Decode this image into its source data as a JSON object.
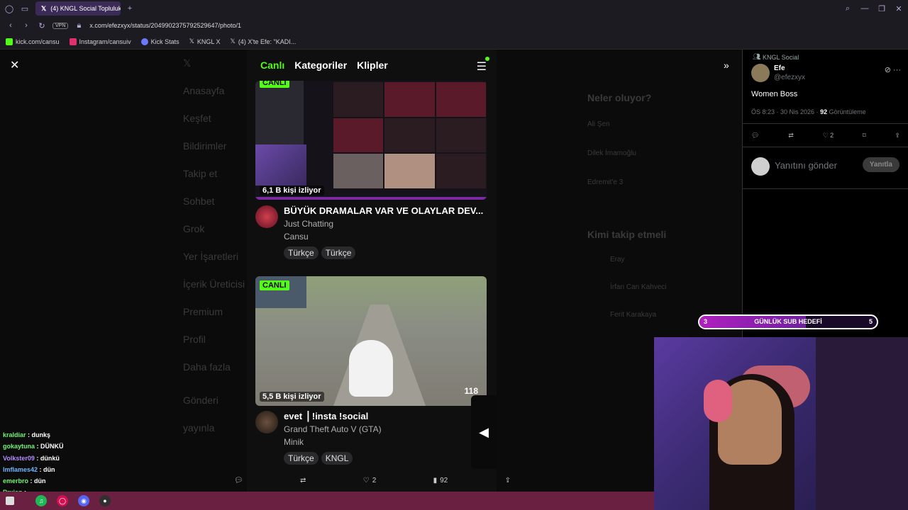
{
  "browser": {
    "tab_title": "(4) KNGL Social Topluluk /",
    "vpn": "VPN",
    "url": "x.com/efezxyx/status/2049902375792529647/photo/1",
    "bookmarks": [
      {
        "label": "kick.com/cansu"
      },
      {
        "label": "Instagram/cansuiv"
      },
      {
        "label": "Kick Stats"
      },
      {
        "label": "KNGL X"
      },
      {
        "label": "(4) X'te Efe: \"KADI..."
      }
    ]
  },
  "kick": {
    "tabs": [
      "Canlı",
      "Kategoriler",
      "Klipler"
    ],
    "streams": [
      {
        "live_badge": "CANLI",
        "viewers": "6,1 B kişi izliyor",
        "title": "BÜYÜK DRAMALAR VAR VE OLAYLAR DEV...",
        "category": "Just Chatting",
        "user": "Cansu",
        "tags": [
          "Türkçe",
          "Türkçe"
        ]
      },
      {
        "live_badge": "CANLI",
        "viewers": "5,5 B kişi izliyor",
        "title": "evet ⎥ !insta !social",
        "category": "Grand Theft Auto V (GTA)",
        "user": "Minik",
        "tags": [
          "Türkçe",
          "KNGL"
        ],
        "speed": "118"
      }
    ]
  },
  "photo_actions": {
    "likes": "2",
    "views": "92"
  },
  "tweet": {
    "community": "KNGL Social",
    "name": "Efe",
    "handle": "@efezxyx",
    "text": "Women Boss",
    "meta_time": "ÖS 8:23 · 30 Nis 2026 · ",
    "meta_views": "92",
    "meta_views_label": " Görüntüleme",
    "likes": "2",
    "reply_placeholder": "Yanıtını gönder",
    "reply_button": "Yanıtla"
  },
  "sub_goal": {
    "label": "GÜNLÜK SUB HEDEFİ",
    "current": "3",
    "target": "5",
    "progress": 0.6
  },
  "chat": [
    {
      "user": "kraldiar",
      "color": "#6ff56f",
      "msg": "dunkş"
    },
    {
      "user": "gokaytuna",
      "color": "#6ff56f",
      "msg": "DÜNKÜ"
    },
    {
      "user": "Volkster09",
      "color": "#b38cff",
      "msg": "dünkü"
    },
    {
      "user": "lmflames42",
      "color": "#6fb8ff",
      "msg": "dün"
    },
    {
      "user": "emerbro",
      "color": "#6ff56f",
      "msg": "dün"
    },
    {
      "user": "Prxien",
      "color": "#6ff56f",
      "msg": ""
    },
    {
      "user": "Efnogu",
      "color": "#ffffff",
      "msg": "dün"
    }
  ],
  "dim_background": {
    "nav": [
      "Anasayfa",
      "Keşfet",
      "Bildirimler",
      "Takip et",
      "Sohbet",
      "Grok",
      "Yer İşaretleri",
      "İçerik Üreticisi",
      "Premium",
      "Profil",
      "Daha fazla"
    ],
    "post_button": "Gönderi yayınla",
    "right": [
      "Neler oluyor?",
      "Ali Şen",
      "Dilek İmamoğlu",
      "Edremit'e 3",
      "Kimi takip etmeli",
      "Eray",
      "İrfan Can Kahveci",
      "Ferit Karakaya"
    ]
  }
}
